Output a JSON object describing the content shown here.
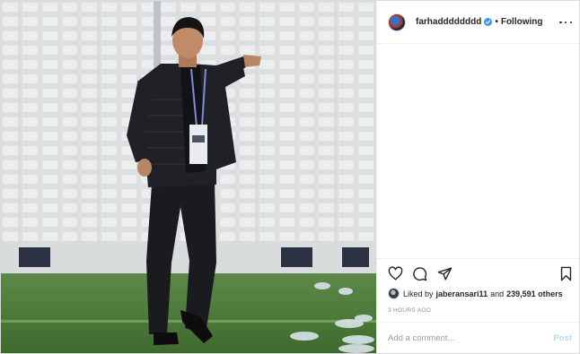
{
  "post": {
    "photo": {
      "subject": "coach-on-sideline",
      "colors": {
        "seats": "#d6dadb",
        "pitch": "#4d7a3a",
        "jacket": "#1c1d20"
      }
    },
    "header": {
      "username": "farhadddddddd",
      "verified": true,
      "separator": "•",
      "follow_label": "Following",
      "more_icon": "more-options-icon"
    },
    "actions": {
      "like_icon": "heart-icon",
      "comment_icon": "comment-icon",
      "share_icon": "share-icon",
      "save_icon": "bookmark-icon"
    },
    "likes": {
      "prefix": "Liked by",
      "first_user": "jaberansari11",
      "conjunction": "and",
      "others": "239,591 others"
    },
    "time_ago": "3 HOURS AGO",
    "comment": {
      "placeholder": "Add a comment...",
      "value": "",
      "post_label": "Post"
    },
    "colors": {
      "accent": "#3897f0",
      "post_disabled": "#b3dbff",
      "border": "#efefef",
      "muted_text": "#8e8e8e"
    }
  }
}
